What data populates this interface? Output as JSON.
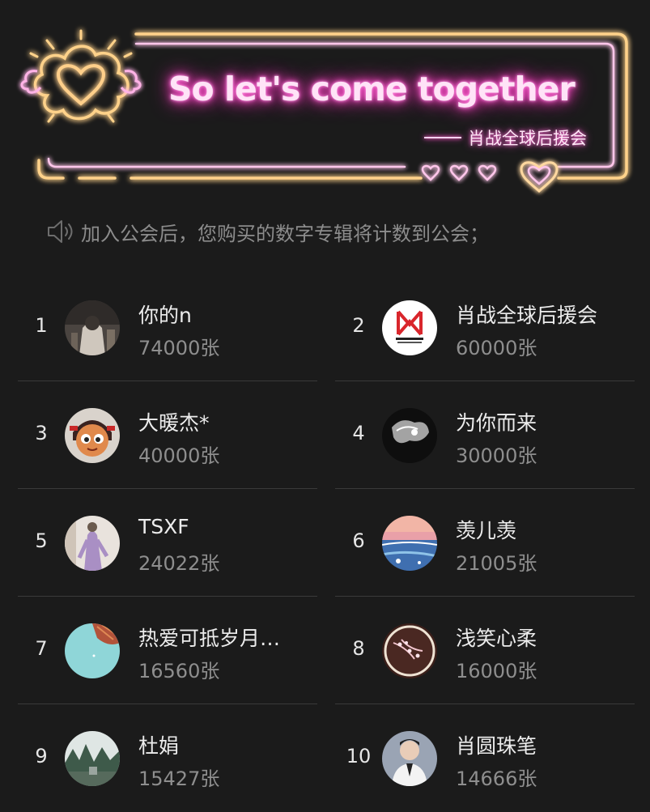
{
  "banner": {
    "title": "So let's come together",
    "subtitle": "肖战全球后援会"
  },
  "notice": {
    "text": "加入公会后，您购买的数字专辑将计数到公会；",
    "icon": "speaker-icon"
  },
  "colors": {
    "background": "#1b1b1b",
    "neon_pink": "#ff3fc4",
    "neon_gold": "#ffb347",
    "divider": "#3a3a3a"
  },
  "ranking": [
    {
      "rank": "1",
      "name": "你的n",
      "count": "74000张"
    },
    {
      "rank": "2",
      "name": "肖战全球后援会",
      "count": "60000张"
    },
    {
      "rank": "3",
      "name": "大暖杰*",
      "count": "40000张"
    },
    {
      "rank": "4",
      "name": "为你而来",
      "count": "30000张"
    },
    {
      "rank": "5",
      "name": "TSXF",
      "count": "24022张"
    },
    {
      "rank": "6",
      "name": "羡儿羡",
      "count": "21005张"
    },
    {
      "rank": "7",
      "name": "热爱可抵岁月…",
      "count": "16560张"
    },
    {
      "rank": "8",
      "name": "浅笑心柔",
      "count": "16000张"
    },
    {
      "rank": "9",
      "name": "杜娟",
      "count": "15427张"
    },
    {
      "rank": "10",
      "name": "肖圆珠笔",
      "count": "14666张"
    }
  ]
}
